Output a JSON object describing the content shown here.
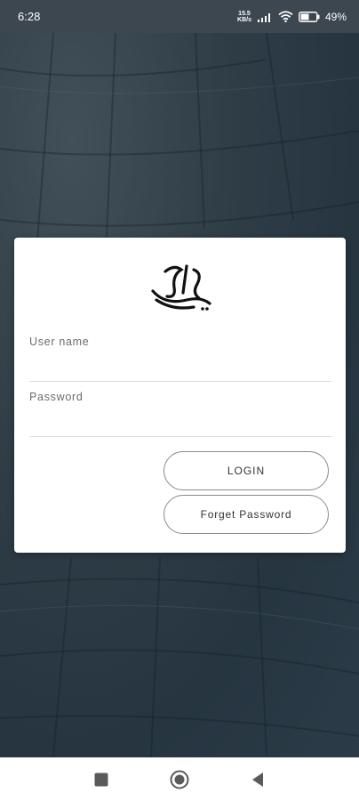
{
  "status_bar": {
    "time": "6:28",
    "net_speed_value": "15.5",
    "net_speed_unit": "KB/s",
    "battery": "49%"
  },
  "login_card": {
    "username_label": "User name",
    "password_label": "Password",
    "login_button": "LOGIN",
    "forget_button": "Forget Password"
  },
  "colors": {
    "background_dark": "#2b3a45",
    "status_bar": "#3d4750",
    "card": "#ffffff"
  },
  "nav_bar": {
    "icons": [
      "square-recents-icon",
      "circle-home-icon",
      "triangle-back-icon"
    ]
  }
}
